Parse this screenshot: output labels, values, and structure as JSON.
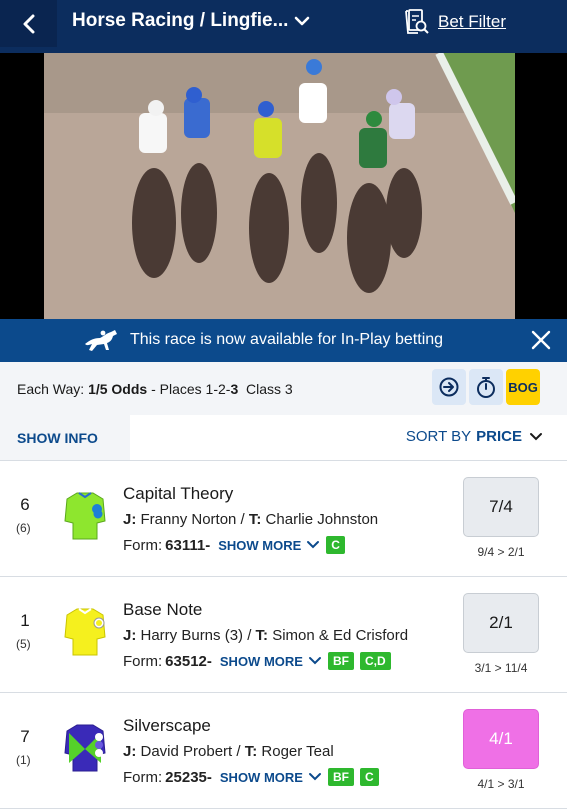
{
  "header": {
    "title": "Horse Racing / Lingfie...",
    "bet_filter": "Bet Filter"
  },
  "banner": {
    "message": "This race is now available for In-Play betting"
  },
  "race_info": {
    "prefix": "Each Way: ",
    "odds": "1/5 Odds",
    "places_text": " - Places 1-2-",
    "places_last": "3",
    "class_text": "  Class 3",
    "bog": "BOG"
  },
  "controls": {
    "show_info": "SHOW INFO",
    "sort_prefix": "SORT BY",
    "sort_value": "PRICE"
  },
  "runners": [
    {
      "number": "6",
      "draw": "(6)",
      "name": "Capital Theory",
      "jockey_label": "J:",
      "jockey": " Franny Norton / ",
      "trainer_label": "T:",
      "trainer": " Charlie Johnston",
      "form_label": "Form:",
      "form": "63111-",
      "show_more": "SHOW MORE",
      "badges": [
        "C"
      ],
      "price": "7/4",
      "movement": "9/4 > 2/1",
      "silk_colors": [
        "#8ee62e",
        "#1e7fd6"
      ]
    },
    {
      "number": "1",
      "draw": "(5)",
      "name": "Base Note",
      "jockey_label": "J:",
      "jockey": " Harry Burns (3) / ",
      "trainer_label": "T:",
      "trainer": " Simon & Ed Crisford",
      "form_label": "Form:",
      "form": "63512-",
      "show_more": "SHOW MORE",
      "badges": [
        "BF",
        "C,D"
      ],
      "price": "2/1",
      "movement": "3/1 > 11/4",
      "silk_colors": [
        "#f5f01e",
        "#ffffff"
      ]
    },
    {
      "number": "7",
      "draw": "(1)",
      "name": "Silverscape",
      "jockey_label": "J:",
      "jockey": " David Probert / ",
      "trainer_label": "T:",
      "trainer": " Roger Teal",
      "form_label": "Form:",
      "form": "25235-",
      "show_more": "SHOW MORE",
      "badges": [
        "BF",
        "C"
      ],
      "price": "4/1",
      "movement": "4/1 > 3/1",
      "silk_colors": [
        "#3a2ab8",
        "#55d12a"
      ]
    }
  ],
  "colors": {
    "header_bg": "#0c2d5e",
    "banner_bg": "#0c4a8c",
    "badge_green": "#2eb82e",
    "price_highlight": "#ef70e6",
    "bog_yellow": "#ffd100"
  }
}
